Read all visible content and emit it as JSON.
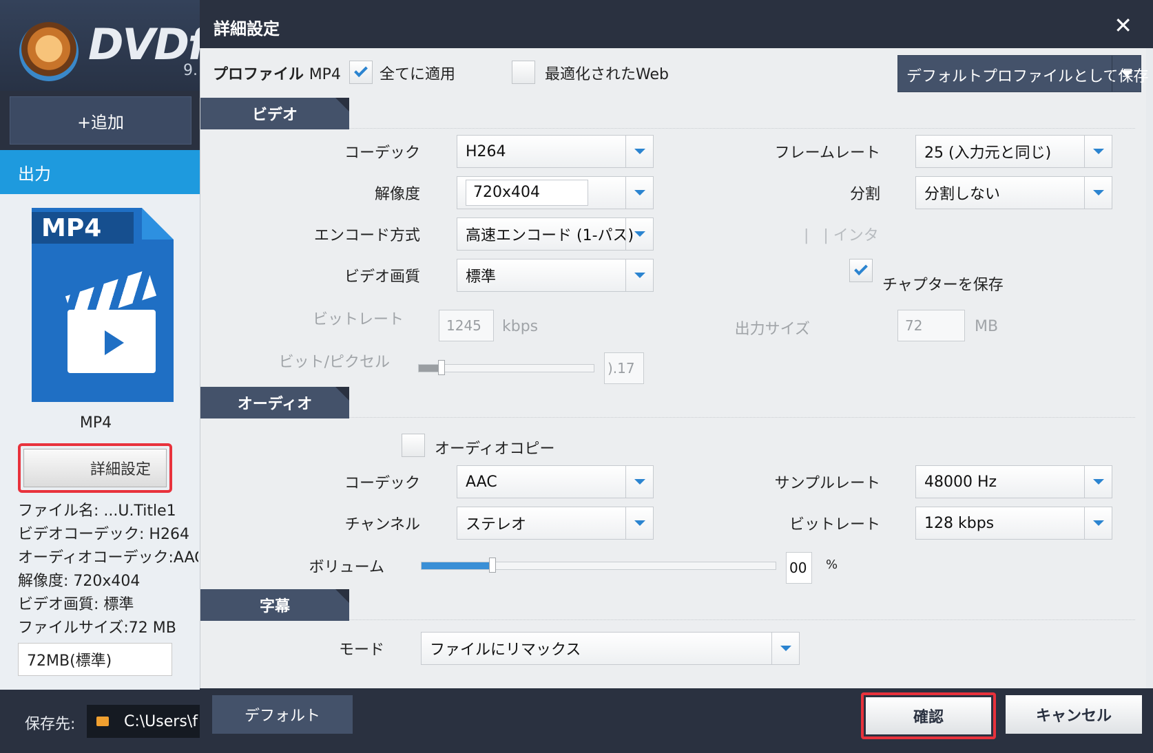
{
  "app": {
    "logo_text": "DVDfa",
    "version": "9.",
    "add_button": "+追加",
    "output_tab": "出力",
    "profile_icon_label": "MP4",
    "profile_caption": "MP4",
    "advanced_button": "詳細設定",
    "file_info": {
      "filename": "ファイル名: ...U.Title1",
      "video_codec": "ビデオコーデック: H264",
      "audio_codec": "オーディオコーデック:AAC",
      "resolution": "解像度: 720x404",
      "video_quality": "ビデオ画質: 標準",
      "file_size": "ファイルサイズ:72 MB"
    },
    "size_select": "72MB(標準)",
    "save_to_label": "保存先:",
    "save_to_path": "C:\\Users\\f"
  },
  "dialog": {
    "title": "詳細設定",
    "close": "✕",
    "profile_label": "プロファイル",
    "profile_value": "MP4",
    "apply_all": {
      "label": "全てに適用",
      "checked": true
    },
    "web_optimized": {
      "label": "最適化されたWeb",
      "checked": false
    },
    "save_default_button": "デフォルトプロファイルとして保存",
    "video": {
      "header": "ビデオ",
      "codec": {
        "label": "コーデック",
        "value": "H264"
      },
      "resolution": {
        "label": "解像度",
        "value": "720x404"
      },
      "encode_method": {
        "label": "エンコード方式",
        "value": "高速エンコード (1-パス)"
      },
      "video_quality": {
        "label": "ビデオ画質",
        "value": "標準"
      },
      "bitrate": {
        "label": "ビットレート",
        "value": "1245",
        "unit": "kbps"
      },
      "bits_per_pixel": {
        "label": "ビット/ピクセル",
        "value": ").17",
        "level": 0.13
      },
      "frame_rate": {
        "label": "フレームレート",
        "value": "25 (入力元と同じ)"
      },
      "split": {
        "label": "分割",
        "value": "分割しない"
      },
      "interlace_label": "| インタ",
      "save_chapters": {
        "label": "チャプターを保存",
        "checked": true
      },
      "output_size": {
        "label": "出力サイズ",
        "value": "72",
        "unit": "MB"
      }
    },
    "audio": {
      "header": "オーディオ",
      "audio_copy": {
        "label": "オーディオコピー",
        "checked": false
      },
      "codec": {
        "label": "コーデック",
        "value": "AAC"
      },
      "channel": {
        "label": "チャンネル",
        "value": "ステレオ"
      },
      "sample_rate": {
        "label": "サンプルレート",
        "value": "48000 Hz"
      },
      "bitrate": {
        "label": "ビットレート",
        "value": "128 kbps"
      },
      "volume": {
        "label": "ボリューム",
        "value": "00",
        "unit": "%",
        "level": 0.2
      }
    },
    "subtitle": {
      "header": "字幕",
      "mode": {
        "label": "モード",
        "value": "ファイルにリマックス"
      }
    },
    "footer": {
      "default_button": "デフォルト",
      "confirm_button": "確認",
      "cancel_button": "キャンセル"
    }
  },
  "colors": {
    "accent_blue": "#1e9ade",
    "dark_chrome": "#2a3140",
    "highlight_red": "#e8323c",
    "dropdown_arrow": "#2b84d0"
  }
}
